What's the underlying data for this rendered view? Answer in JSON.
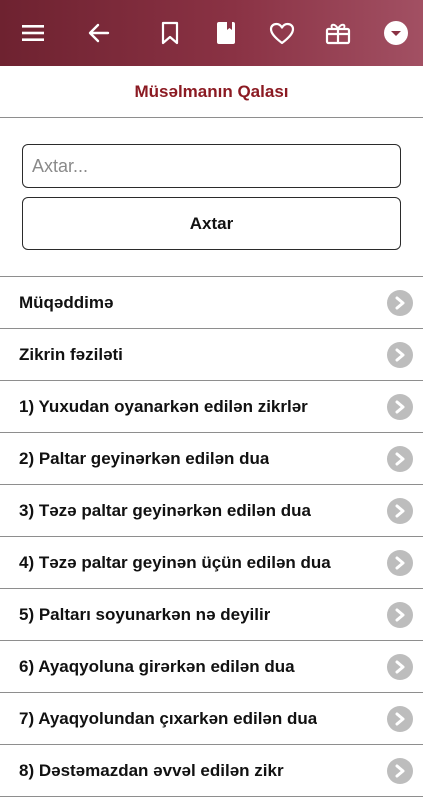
{
  "toolbar": {
    "background": "#7a2837",
    "icons": [
      "menu-icon",
      "back-arrow-icon",
      "bookmark-icon",
      "book-icon",
      "heart-icon",
      "gift-icon",
      "dropdown-icon"
    ]
  },
  "header": {
    "title": "Müsəlmanın Qalası"
  },
  "search": {
    "placeholder": "Axtar...",
    "value": "",
    "button_label": "Axtar"
  },
  "list": {
    "items": [
      {
        "label": "Müqəddimə"
      },
      {
        "label": "Zikrin fəziləti"
      },
      {
        "label": "1) Yuxudan oyanarkən edilən zikrlər"
      },
      {
        "label": "2) Paltar geyinərkən edilən dua"
      },
      {
        "label": "3) Təzə paltar geyinərkən edilən dua"
      },
      {
        "label": "4) Təzə paltar geyinən üçün edilən dua"
      },
      {
        "label": "5) Paltarı soyunarkən nə deyilir"
      },
      {
        "label": "6) Ayaqyoluna girərkən edilən dua"
      },
      {
        "label": "7) Ayaqyolundan çıxarkən edilən dua"
      },
      {
        "label": "8) Dəstəmazdan əvvəl edilən zikr"
      }
    ]
  },
  "colors": {
    "title": "#8b1a22",
    "chevron": "#bdbdbd",
    "divider": "#8e8e8e"
  }
}
